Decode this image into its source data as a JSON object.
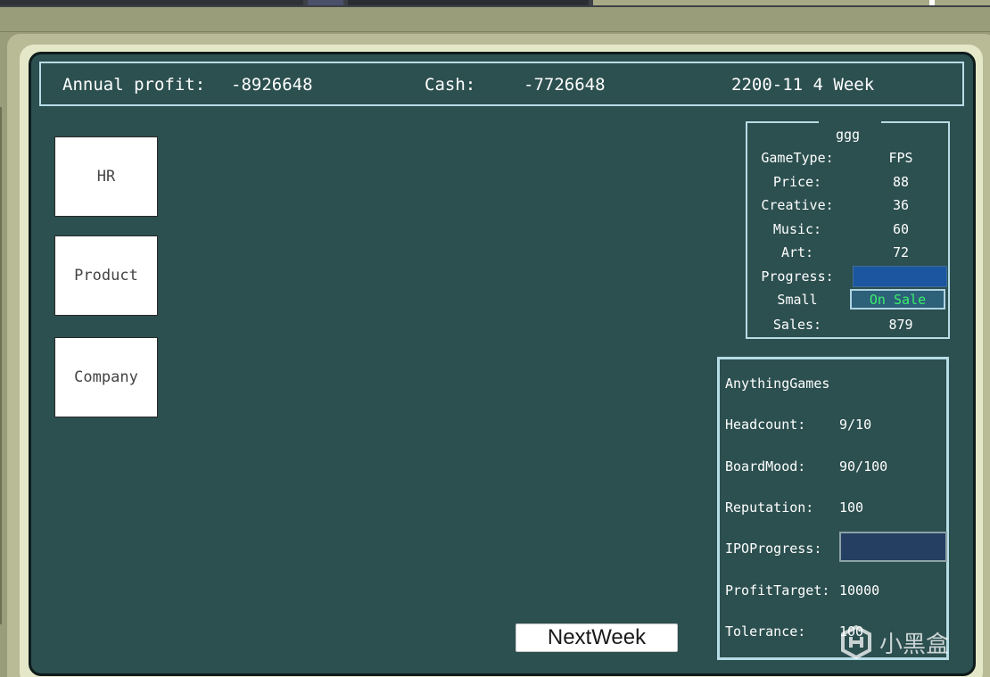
{
  "header": {
    "annual_profit_label": "Annual profit:",
    "annual_profit_value": "-8926648",
    "cash_label": "Cash:",
    "cash_value": "-7726648",
    "date": "2200-11 4 Week"
  },
  "nav": {
    "hr": "HR",
    "product": "Product",
    "company": "Company"
  },
  "product": {
    "name": "ggg",
    "game_type_label": "GameType:",
    "game_type_value": "FPS",
    "price_label": "Price:",
    "price_value": "88",
    "creative_label": "Creative:",
    "creative_value": "36",
    "music_label": "Music:",
    "music_value": "60",
    "art_label": "Art:",
    "art_value": "72",
    "progress_label": "Progress:",
    "progress_fraction": 1.0,
    "size_label": "Small",
    "status": "On Sale",
    "sales_label": "Sales:",
    "sales_value": "879"
  },
  "company": {
    "name": "AnythingGames",
    "headcount_label": "Headcount:",
    "headcount_value": "9/10",
    "boardmood_label": "BoardMood:",
    "boardmood_value": "90/100",
    "reputation_label": "Reputation:",
    "reputation_value": "100",
    "ipo_label": "IPOProgress:",
    "ipo_fraction": 0.0,
    "profit_target_label": "ProfitTarget:",
    "profit_target_value": "10000",
    "tolerance_label": "Tolerance:",
    "tolerance_value": "100"
  },
  "next_week_label": "NextWeek",
  "watermark_text": "小黑盒",
  "colors": {
    "screen_bg": "#2c4f4f",
    "panel_border": "#b6dde6",
    "progress_blue": "#1c56a0",
    "on_sale_green": "#39f06b",
    "frame_cream": "#e5e8c8"
  }
}
